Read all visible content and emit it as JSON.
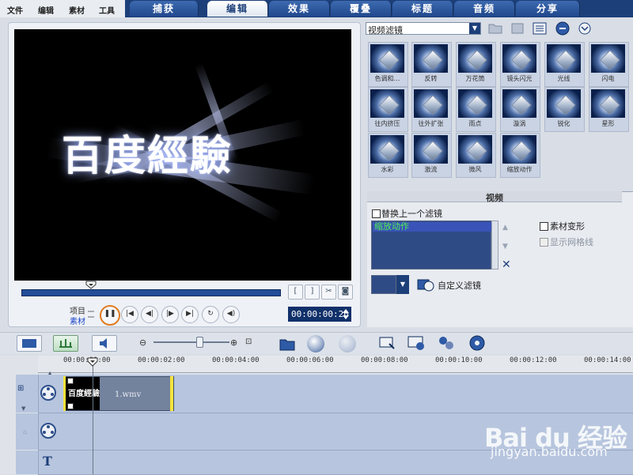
{
  "menu": [
    "文件",
    "编辑",
    "素材",
    "工具"
  ],
  "tabs": [
    {
      "label": "捕获",
      "active": false
    },
    {
      "label": "编辑",
      "active": true
    },
    {
      "label": "效果",
      "active": false
    },
    {
      "label": "覆叠",
      "active": false
    },
    {
      "label": "标题",
      "active": false
    },
    {
      "label": "音频",
      "active": false
    },
    {
      "label": "分享",
      "active": false
    }
  ],
  "preview": {
    "overlay_text": "百度經驗",
    "mode_project": "项目",
    "mode_clip": "素材",
    "timecode": "00:00:00:20"
  },
  "library": {
    "category": "视频滤镜",
    "filters": [
      "色调和…",
      "反转",
      "万花筒",
      "镜头闪光",
      "光线",
      "闪电",
      "往内挤压",
      "往外扩张",
      "雨点",
      "漩涡",
      "锐化",
      "星形",
      "水彩",
      "激流",
      "微风",
      "缩放动作"
    ]
  },
  "properties": {
    "header": "视频",
    "replace_last_filter": "替换上一个滤镜",
    "applied_filters": [
      "缩放动作"
    ],
    "clip_transform": "素材变形",
    "show_grid": "显示网格线",
    "custom_filter": "自定义滤镜"
  },
  "timeline": {
    "ruler": [
      "00:00:00:00",
      "00:00:02:00",
      "00:00:04:00",
      "00:00:06:00",
      "00:00:08:00",
      "00:00:10:00",
      "00:00:12:00",
      "00:00:14:00"
    ],
    "clip_name": "1.wmv",
    "clip_thumb_text": "百度經驗"
  },
  "watermark": {
    "brand": "Bai du 经验",
    "url": "jingyan.baidu.com"
  },
  "colors": {
    "tab_bar": "#1d3f79",
    "accent_green": "#4ff04f",
    "clip_trim": "#f7e33b"
  }
}
